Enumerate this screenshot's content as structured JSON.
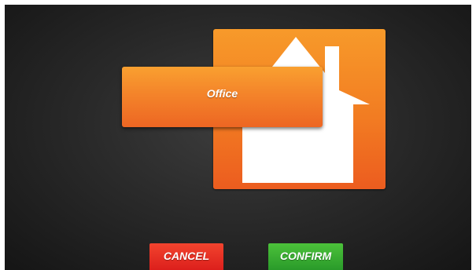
{
  "room": {
    "name": "Office",
    "icon": "house-icon"
  },
  "actions": {
    "cancel_label": "CANCEL",
    "confirm_label": "CONFIRM"
  },
  "colors": {
    "tile_orange": "#f27c22",
    "cancel_red": "#dc1f1c",
    "confirm_green": "#2a9a2a"
  }
}
